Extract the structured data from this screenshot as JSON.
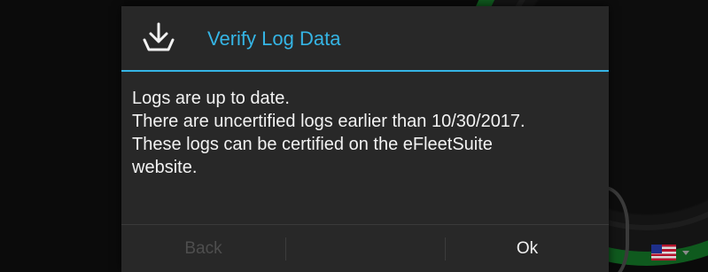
{
  "dialog": {
    "title": "Verify Log Data",
    "icon": "download-tray-icon",
    "message_lines": [
      "Logs are up to date.",
      "There are uncertified logs earlier than 10/30/2017.",
      "These logs can be certified on the eFleetSuite",
      "website."
    ],
    "buttons": {
      "back_label": "Back",
      "back_enabled": false,
      "ok_label": "Ok"
    }
  },
  "background": {
    "language_flag": "us-flag-icon"
  },
  "colors": {
    "accent": "#35b5e5",
    "dialog_bg": "#282828",
    "text": "#f2f2f2",
    "disabled_text": "#4e4e4e",
    "gauge_green": "#0f5a1e"
  }
}
